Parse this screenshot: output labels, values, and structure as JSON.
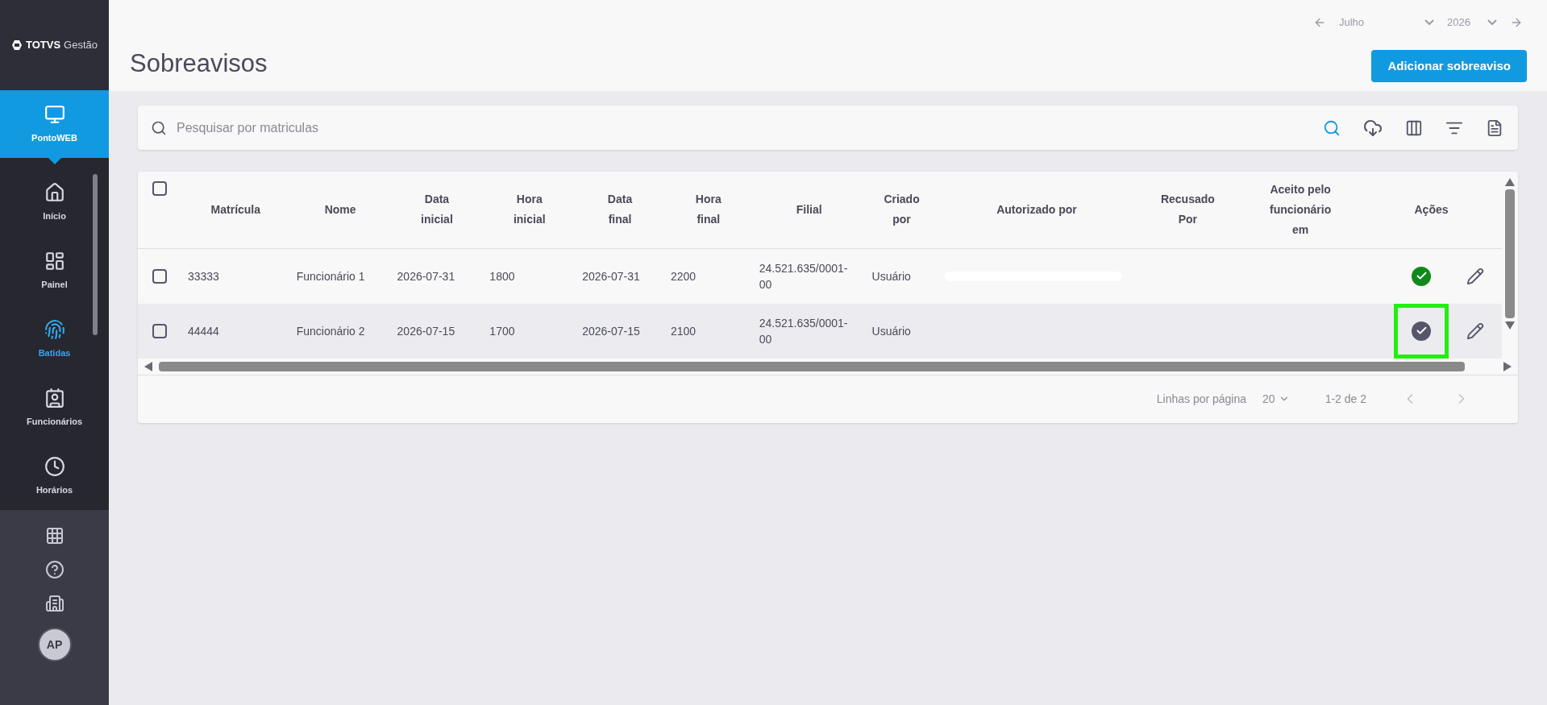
{
  "sidebar": {
    "logo": {
      "brand": "TOTVS",
      "product": "Gestão"
    },
    "module": {
      "label": "PontoWEB",
      "selected": true
    },
    "items": [
      {
        "label": "Início",
        "kind": "home",
        "selected": false
      },
      {
        "label": "Painel",
        "kind": "dashboard",
        "selected": false
      },
      {
        "label": "Batidas",
        "kind": "fingerprint",
        "selected": true
      },
      {
        "label": "Funcionários",
        "kind": "badge",
        "selected": false
      },
      {
        "label": "Horários",
        "kind": "clock",
        "selected": false
      }
    ],
    "bottom": [
      {
        "kind": "apps"
      },
      {
        "kind": "help"
      },
      {
        "kind": "building"
      }
    ],
    "avatar": "AP"
  },
  "period": {
    "month": "Julho",
    "year": "2026"
  },
  "page_title": "Sobreavisos",
  "add_button": "Adicionar sobreaviso",
  "search": {
    "placeholder": "Pesquisar por matriculas"
  },
  "table": {
    "all_checked": false,
    "columns": [
      "Matrícula",
      "Nome",
      "Data inicial",
      "Hora inicial",
      "Data final",
      "Hora final",
      "Filial",
      "Criado por",
      "Autorizado por",
      "Recusado Por",
      "Aceito pelo funcionário em",
      "Ações"
    ],
    "rows": [
      {
        "checked": false,
        "cells": [
          "33333",
          "Funcionário 1",
          "2026-07-31",
          "1800",
          "2026-07-31",
          "2200",
          "24.521.635/0001-00",
          "Usuário",
          "",
          "",
          ""
        ],
        "authorized_redacted": true,
        "color": "#0e8a1a",
        "highlighted": false
      },
      {
        "checked": false,
        "cells": [
          "44444",
          "Funcionário 2",
          "2026-07-15",
          "1700",
          "2026-07-15",
          "2100",
          "24.521.635/0001-00",
          "Usuário",
          "",
          "",
          ""
        ],
        "authorized_redacted": false,
        "color": "#55566a",
        "highlighted": true
      }
    ]
  },
  "pagination": {
    "rows_label": "Linhas por página",
    "rows_value": "20",
    "range": "1-2 de 2"
  }
}
